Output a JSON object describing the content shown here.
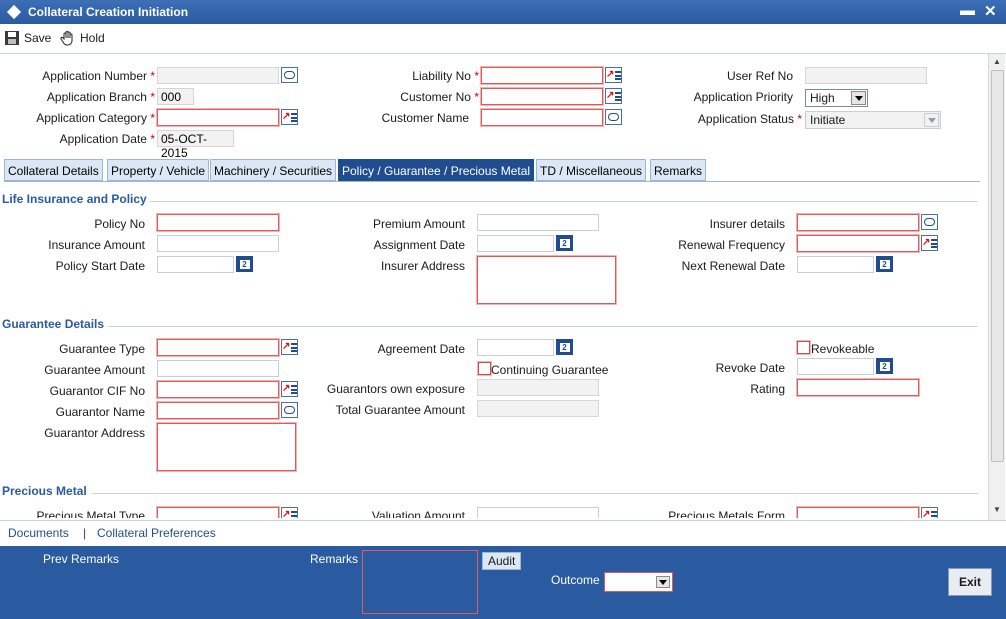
{
  "window": {
    "title": "Collateral Creation Initiation",
    "minimize": "▬",
    "close": "✕"
  },
  "toolbar": {
    "save_label": "Save",
    "hold_label": "Hold"
  },
  "header": {
    "application_number_label": "Application Number",
    "application_branch_label": "Application Branch",
    "application_branch_value": "000",
    "application_category_label": "Application Category",
    "application_date_label": "Application Date",
    "application_date_value": "05-OCT-2015",
    "liability_no_label": "Liability No",
    "customer_no_label": "Customer No",
    "customer_name_label": "Customer Name",
    "user_ref_no_label": "User Ref No",
    "application_priority_label": "Application Priority",
    "application_priority_value": "High",
    "application_status_label": "Application Status",
    "application_status_value": "Initiate",
    "required_mark": "*"
  },
  "tabs": [
    {
      "label": "Collateral Details"
    },
    {
      "label": "Property / Vehicle"
    },
    {
      "label": "Machinery / Securities"
    },
    {
      "label": "Policy / Guarantee / Precious Metal",
      "active": true
    },
    {
      "label": "TD / Miscellaneous"
    },
    {
      "label": "Remarks"
    }
  ],
  "life_insurance": {
    "title": "Life Insurance and Policy",
    "policy_no_label": "Policy No",
    "insurance_amount_label": "Insurance Amount",
    "policy_start_date_label": "Policy Start Date",
    "premium_amount_label": "Premium Amount",
    "assignment_date_label": "Assignment Date",
    "insurer_address_label": "Insurer Address",
    "insurer_details_label": "Insurer details",
    "renewal_frequency_label": "Renewal Frequency",
    "next_renewal_date_label": "Next Renewal Date"
  },
  "guarantee": {
    "title": "Guarantee Details",
    "guarantee_type_label": "Guarantee Type",
    "guarantee_amount_label": "Guarantee Amount",
    "guarantor_cif_no_label": "Guarantor CIF No",
    "guarantor_name_label": "Guarantor Name",
    "guarantor_address_label": "Guarantor Address",
    "agreement_date_label": "Agreement Date",
    "continuing_guarantee_label": "Continuing Guarantee",
    "guarantors_own_exposure_label": "Guarantors own exposure",
    "total_guarantee_amount_label": "Total Guarantee Amount",
    "revokeable_label": "Revokeable",
    "revoke_date_label": "Revoke Date",
    "rating_label": "Rating"
  },
  "precious_metal": {
    "title": "Precious Metal",
    "precious_metal_type_label": "Precious Metal Type",
    "valuation_amount_label": "Valuation Amount",
    "precious_metals_form_label": "Precious Metals Form"
  },
  "footer_links": {
    "documents": "Documents",
    "separator": "|",
    "collateral_preferences": "Collateral Preferences"
  },
  "bottom": {
    "prev_remarks_label": "Prev Remarks",
    "remarks_label": "Remarks",
    "audit_label": "Audit",
    "outcome_label": "Outcome",
    "exit_label": "Exit"
  },
  "icons": {
    "lov": "lov-icon",
    "comment": "comment-icon",
    "calendar": "calendar-icon",
    "calendar_glyph": "2",
    "lov_arrow_glyph": "↗"
  },
  "colors": {
    "title_bar": "#2a5aa0",
    "active_tab": "#1f4d8f",
    "mandatory_border": "#e05a5a"
  }
}
